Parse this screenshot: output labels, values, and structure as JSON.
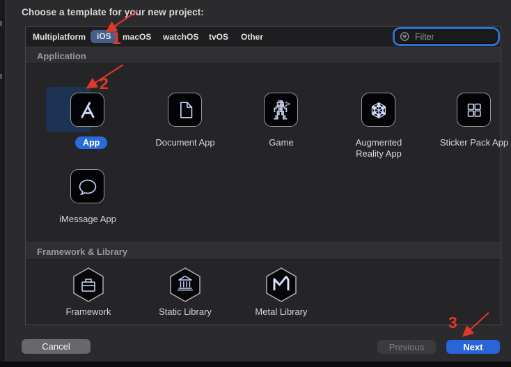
{
  "window": {
    "title": "Choose a template for your new project:"
  },
  "tabs": {
    "items": [
      {
        "label": "Multiplatform",
        "selected": false
      },
      {
        "label": "iOS",
        "selected": true
      },
      {
        "label": "macOS",
        "selected": false
      },
      {
        "label": "watchOS",
        "selected": false
      },
      {
        "label": "tvOS",
        "selected": false
      },
      {
        "label": "Other",
        "selected": false
      }
    ],
    "filter": {
      "placeholder": "Filter"
    }
  },
  "sections": [
    {
      "header": "Application",
      "items": [
        {
          "label": "App",
          "icon": "app-store-icon",
          "selected": true
        },
        {
          "label": "Document App",
          "icon": "document-icon",
          "selected": false
        },
        {
          "label": "Game",
          "icon": "game-pixel-robot-icon",
          "selected": false
        },
        {
          "label": "Augmented Reality App",
          "icon": "ar-cube-icon",
          "selected": false
        },
        {
          "label": "Sticker Pack App",
          "icon": "sticker-grid-icon",
          "selected": false
        },
        {
          "label": "iMessage App",
          "icon": "message-bubble-icon",
          "selected": false
        }
      ]
    },
    {
      "header": "Framework & Library",
      "items": [
        {
          "label": "Framework",
          "icon": "toolbox-hexagon-icon"
        },
        {
          "label": "Static Library",
          "icon": "bank-hexagon-icon"
        },
        {
          "label": "Metal Library",
          "icon": "metal-hexagon-icon"
        }
      ]
    }
  ],
  "footer": {
    "cancel_label": "Cancel",
    "previous_label": "Previous",
    "next_label": "Next",
    "previous_enabled": false
  },
  "annotations": {
    "color": "#e2382a",
    "steps": [
      {
        "number": "1"
      },
      {
        "number": "2"
      },
      {
        "number": "3"
      }
    ]
  },
  "colors": {
    "dialog_background": "#2b2b2d",
    "selected_tab_pill": "#42608a",
    "selection_highlight": "#1d3353",
    "selected_label_pill": "#2a6bdb",
    "next_button_blue": "#2765d8",
    "filter_focus_ring": "#2e6fd0",
    "annotation_red": "#e2382a",
    "icon_glyph": "#ccd8f8"
  },
  "icons": {
    "game_pixel_rows": [
      "....111.....",
      "...11111.1..",
      "...1.111..11",
      "...11111.1..",
      "..1111111...",
      ".11.111.11..",
      ".1..111..1..",
      ".1.11111.1..",
      "...11.11....",
      "...11.11....",
      "..11...11...",
      "..11...11...",
      ".111...111.."
    ]
  }
}
